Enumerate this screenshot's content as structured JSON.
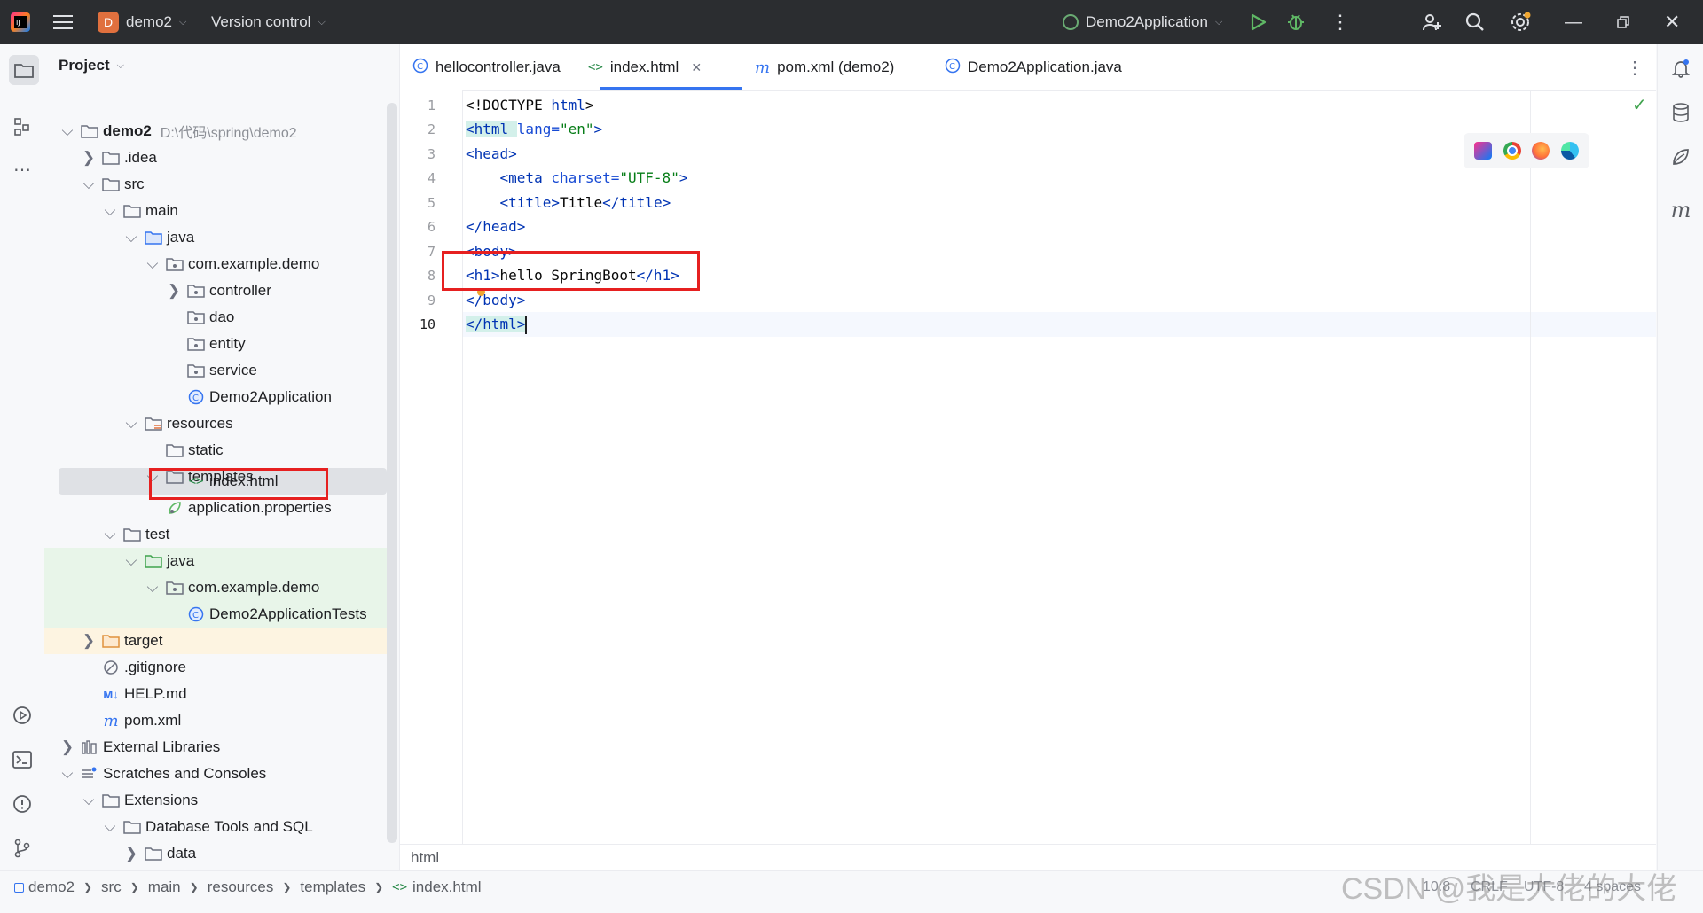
{
  "titlebar": {
    "project_initial": "D",
    "project_name": "demo2",
    "vcs_label": "Version control",
    "run_config": "Demo2Application"
  },
  "project_panel": {
    "title": "Project",
    "tree": [
      {
        "label": "demo2",
        "path": "D:\\代码\\spring\\demo2",
        "icon": "folder-icon"
      },
      {
        "label": ".idea",
        "icon": "folder-icon"
      },
      {
        "label": "src",
        "icon": "folder-icon"
      },
      {
        "label": "main",
        "icon": "folder-icon"
      },
      {
        "label": "java",
        "icon": "source-folder-icon"
      },
      {
        "label": "com.example.demo",
        "icon": "package-icon"
      },
      {
        "label": "controller",
        "icon": "package-icon"
      },
      {
        "label": "dao",
        "icon": "package-icon"
      },
      {
        "label": "entity",
        "icon": "package-icon"
      },
      {
        "label": "service",
        "icon": "package-icon"
      },
      {
        "label": "Demo2Application",
        "icon": "spring-class-icon"
      },
      {
        "label": "resources",
        "icon": "resources-folder-icon"
      },
      {
        "label": "static",
        "icon": "folder-icon"
      },
      {
        "label": "templates",
        "icon": "folder-icon"
      },
      {
        "label": "index.html",
        "icon": "html-file-icon"
      },
      {
        "label": "application.properties",
        "icon": "properties-file-icon"
      },
      {
        "label": "test",
        "icon": "folder-icon"
      },
      {
        "label": "java",
        "icon": "test-folder-icon"
      },
      {
        "label": "com.example.demo",
        "icon": "package-icon"
      },
      {
        "label": "Demo2ApplicationTests",
        "icon": "class-icon"
      },
      {
        "label": "target",
        "icon": "excluded-folder-icon"
      },
      {
        "label": ".gitignore",
        "icon": "ignore-file-icon"
      },
      {
        "label": "HELP.md",
        "icon": "markdown-file-icon"
      },
      {
        "label": "pom.xml",
        "icon": "maven-file-icon"
      },
      {
        "label": "External Libraries",
        "icon": "libraries-icon"
      },
      {
        "label": "Scratches and Consoles",
        "icon": "scratches-icon"
      },
      {
        "label": "Extensions",
        "icon": "folder-icon"
      },
      {
        "label": "Database Tools and SQL",
        "icon": "folder-icon"
      },
      {
        "label": "data",
        "icon": "folder-icon"
      }
    ]
  },
  "tabs": [
    {
      "label": "hellocontroller.java",
      "icon": "class-icon"
    },
    {
      "label": "index.html",
      "icon": "html-file-icon"
    },
    {
      "label": "pom.xml (demo2)",
      "icon": "maven-file-icon"
    },
    {
      "label": "Demo2Application.java",
      "icon": "spring-class-icon"
    }
  ],
  "editor": {
    "line_numbers": [
      "1",
      "2",
      "3",
      "4",
      "5",
      "6",
      "7",
      "8",
      "9",
      "10"
    ],
    "code": {
      "l1a": "<!DOCTYPE ",
      "l1b": "html",
      "l1c": ">",
      "l2a": "<html ",
      "l2b": "lang=",
      "l2c": "\"en\"",
      "l2d": ">",
      "l3a": "<head>",
      "l4a": "    <meta ",
      "l4b": "charset=",
      "l4c": "\"UTF-8\"",
      "l4d": ">",
      "l5a": "    <title>",
      "l5b": "Title",
      "l5c": "</title>",
      "l6a": "</head>",
      "l7a": "<body>",
      "l8a": "<h1>",
      "l8b": "hello SpringBoot",
      "l8c": "</h1>",
      "l9a": "</body>",
      "l10a": "</html>"
    },
    "bottom_label": "html"
  },
  "statusbar": {
    "breadcrumbs": [
      "demo2",
      "src",
      "main",
      "resources",
      "templates",
      "index.html"
    ],
    "position": "10:8",
    "line_sep": "CRLF",
    "encoding": "UTF-8",
    "indent": "4 spaces",
    "watermark": "CSDN @我是大佬的大佬"
  },
  "colors": {
    "accent": "#3574f0",
    "highlight_box": "#e62020",
    "run": "#3fa34d"
  }
}
